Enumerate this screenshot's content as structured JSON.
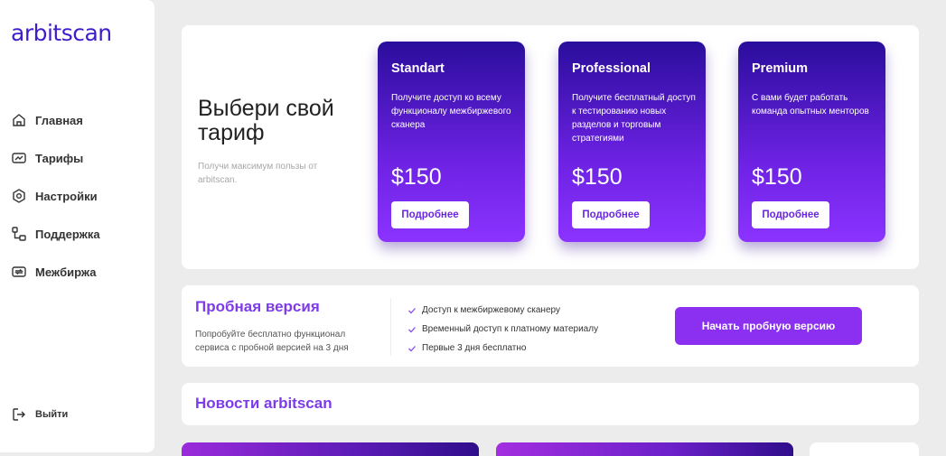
{
  "sidebar": {
    "logo": "arbitscan",
    "items": [
      {
        "label": "Главная",
        "icon": "home-icon"
      },
      {
        "label": "Тарифы",
        "icon": "ticket-icon"
      },
      {
        "label": "Настройки",
        "icon": "settings-icon"
      },
      {
        "label": "Поддержка",
        "icon": "support-icon"
      },
      {
        "label": "Межбиржа",
        "icon": "exchange-icon"
      }
    ],
    "logout": "Выйти"
  },
  "tariffs": {
    "title": "Выбери свой тариф",
    "subtitle": "Получи максимум пользы от arbitscan.",
    "cards": [
      {
        "name": "Standart",
        "desc": "Получите доступ ко всему функционалу межбиржевого сканера",
        "price": "$150",
        "button": "Подробнее"
      },
      {
        "name": "Professional",
        "desc": "Получите бесплатный доступ к тестированию новых разделов и торговым стратегиями",
        "price": "$150",
        "button": "Подробнее"
      },
      {
        "name": "Premium",
        "desc": "С вами будет работать команда опытных менторов",
        "price": "$150",
        "button": "Подробнее"
      }
    ]
  },
  "trial": {
    "title": "Пробная версия",
    "desc": "Попробуйте бесплатно функционал сервиса с пробной версией на 3 дня",
    "checks": [
      "Доступ к межбиржевому сканеру",
      "Временный доступ к платному материалу",
      "Первые 3 дня бесплатно"
    ],
    "button": "Начать пробную версию"
  },
  "news": {
    "title": "Новости arbitscan"
  },
  "colors": {
    "accent": "#7d3bea",
    "button": "#8b2ff0",
    "logo": "#3f1dcb"
  }
}
